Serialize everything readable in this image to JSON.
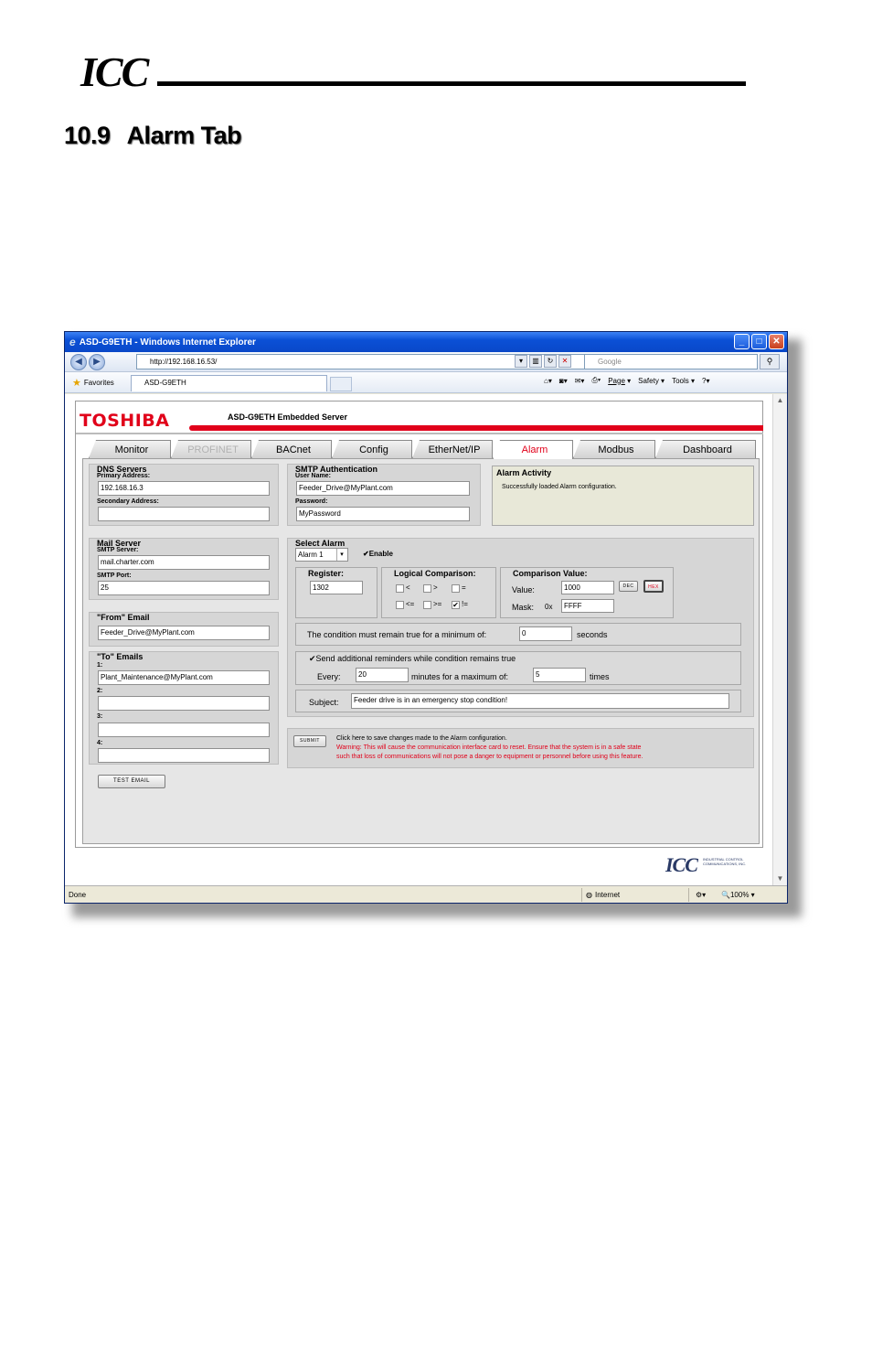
{
  "doc": {
    "logo": "ICC",
    "section_number": "10.9",
    "section_title": "Alarm Tab"
  },
  "browser": {
    "window_title": "ASD-G9ETH - Windows Internet Explorer",
    "address": "http://192.168.16.53/",
    "search_placeholder": "Google",
    "favorites_label": "Favorites",
    "tab_title": "ASD-G9ETH",
    "commands": [
      "Page",
      "Safety",
      "Tools"
    ],
    "status_left": "Done",
    "status_zone": "Internet",
    "status_zoom": "100%"
  },
  "page": {
    "brand": "TOSHIBA",
    "server_title": "ASD-G9ETH Embedded Server",
    "tabs": [
      {
        "label": "Monitor",
        "state": "normal"
      },
      {
        "label": "PROFINET",
        "state": "disabled"
      },
      {
        "label": "BACnet",
        "state": "normal"
      },
      {
        "label": "Config",
        "state": "normal"
      },
      {
        "label": "EtherNet/IP",
        "state": "normal"
      },
      {
        "label": "Alarm",
        "state": "active"
      },
      {
        "label": "Modbus",
        "state": "normal"
      },
      {
        "label": "Dashboard",
        "state": "normal"
      }
    ],
    "dns": {
      "title": "DNS Servers",
      "primary_label": "Primary Address:",
      "primary_value": "192.168.16.3",
      "secondary_label": "Secondary Address:",
      "secondary_value": ""
    },
    "mail": {
      "title": "Mail Server",
      "server_label": "SMTP Server:",
      "server_value": "mail.charter.com",
      "port_label": "SMTP Port:",
      "port_value": "25"
    },
    "from": {
      "title": "\"From\" Email",
      "value": "Feeder_Drive@MyPlant.com"
    },
    "to": {
      "title": "\"To\" Emails",
      "entries": [
        {
          "label": "1:",
          "value": "Plant_Maintenance@MyPlant.com"
        },
        {
          "label": "2:",
          "value": ""
        },
        {
          "label": "3:",
          "value": ""
        },
        {
          "label": "4:",
          "value": ""
        }
      ]
    },
    "test_email_button": "TEST EMAIL",
    "smtp_auth": {
      "title": "SMTP Authentication",
      "user_label": "User Name:",
      "user_value": "Feeder_Drive@MyPlant.com",
      "password_label": "Password:",
      "password_value": "MyPassword"
    },
    "activity": {
      "title": "Alarm Activity",
      "message": "Successfully loaded Alarm configuration."
    },
    "alarm": {
      "title": "Select Alarm",
      "selected": "Alarm 1",
      "enable_label": "Enable",
      "enable_checked": true,
      "register_label": "Register:",
      "register_value": "1302",
      "logic_label": "Logical Comparison:",
      "logic_options": [
        {
          "label": "<",
          "checked": false
        },
        {
          "label": ">",
          "checked": false
        },
        {
          "label": "=",
          "checked": false
        },
        {
          "label": "<=",
          "checked": false
        },
        {
          "label": ">=",
          "checked": false
        },
        {
          "label": "!=",
          "checked": true
        }
      ],
      "comparison_label": "Comparison Value:",
      "value_label": "Value:",
      "value": "1000",
      "mask_label": "Mask:",
      "mask_prefix": "0x",
      "mask_value": "FFFF",
      "dec_button": "DEC",
      "hex_button": "HEX",
      "duration_prefix": "The condition must remain true for a minimum of:",
      "duration_value": "0",
      "duration_suffix": "seconds",
      "reminders_label": "Send additional reminders while condition remains true",
      "reminders_checked": true,
      "every_label": "Every:",
      "every_value": "20",
      "max_label": "minutes for a maximum of:",
      "max_value": "5",
      "times_label": "times",
      "subject_label": "Subject:",
      "subject_value": "Feeder drive is in an emergency stop condition!"
    },
    "submit": {
      "button": "SUBMIT",
      "info": "Click here to save changes made to the Alarm configuration.",
      "warning_1": "Warning: This will cause the communication interface card to reset. Ensure that the system is in a safe state",
      "warning_2": "such that loss of communications will not pose a danger to equipment or personnel before using this feature."
    },
    "footer_logo": "ICC",
    "footer_text": "INDUSTRIAL CONTROL COMMUNICATIONS, INC."
  },
  "colors": {
    "brand_red": "#e1001a",
    "panel_grey": "#d6d6d6",
    "titlebar_blue": "#0b50d6"
  }
}
